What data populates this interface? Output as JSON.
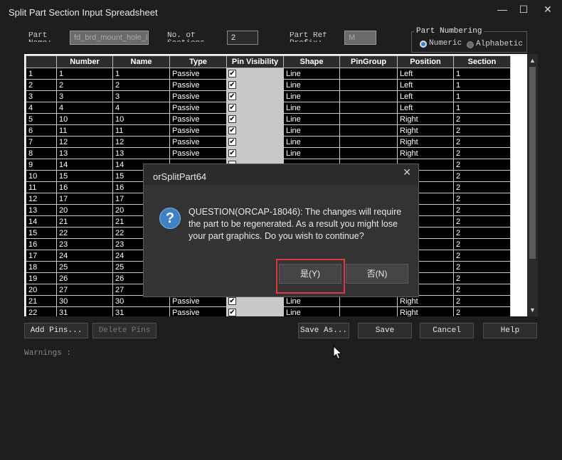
{
  "window": {
    "title": "Split Part Section Input Spreadsheet",
    "minimize": "—",
    "maximize": "☐",
    "close": "✕"
  },
  "form": {
    "part_name_label": "Part Name:",
    "part_name_value": "fd_brd_mount_hole_ii",
    "sections_label": "No. of Sections:",
    "sections_value": "2",
    "prefix_label": "Part Ref Prefix:",
    "prefix_value": "M",
    "numbering_title": "Part Numbering",
    "numeric_label": "Numeric",
    "alphabetic_label": "Alphabetic",
    "numbering_selected": "Numeric"
  },
  "grid": {
    "columns": [
      "",
      "Number",
      "Name",
      "Type",
      "Pin Visibility",
      "Shape",
      "PinGroup",
      "Position",
      "Section"
    ],
    "rows": [
      [
        "1",
        "1",
        "1",
        "Passive",
        "✔",
        "Line",
        "",
        "Left",
        "1"
      ],
      [
        "2",
        "2",
        "2",
        "Passive",
        "✔",
        "Line",
        "",
        "Left",
        "1"
      ],
      [
        "3",
        "3",
        "3",
        "Passive",
        "✔",
        "Line",
        "",
        "Left",
        "1"
      ],
      [
        "4",
        "4",
        "4",
        "Passive",
        "✔",
        "Line",
        "",
        "Left",
        "1"
      ],
      [
        "5",
        "10",
        "10",
        "Passive",
        "✔",
        "Line",
        "",
        "Right",
        "2"
      ],
      [
        "6",
        "11",
        "11",
        "Passive",
        "✔",
        "Line",
        "",
        "Right",
        "2"
      ],
      [
        "7",
        "12",
        "12",
        "Passive",
        "✔",
        "Line",
        "",
        "Right",
        "2"
      ],
      [
        "8",
        "13",
        "13",
        "Passive",
        "✔",
        "Line",
        "",
        "Right",
        "2"
      ],
      [
        "9",
        "14",
        "14",
        "",
        "",
        "",
        "",
        "",
        "2"
      ],
      [
        "10",
        "15",
        "15",
        "",
        "",
        "",
        "",
        "",
        "2"
      ],
      [
        "11",
        "16",
        "16",
        "",
        "",
        "",
        "",
        "",
        "2"
      ],
      [
        "12",
        "17",
        "17",
        "",
        "",
        "",
        "",
        "",
        "2"
      ],
      [
        "13",
        "20",
        "20",
        "",
        "",
        "",
        "",
        "",
        "2"
      ],
      [
        "14",
        "21",
        "21",
        "",
        "",
        "",
        "",
        "",
        "2"
      ],
      [
        "15",
        "22",
        "22",
        "",
        "",
        "",
        "",
        "",
        "2"
      ],
      [
        "16",
        "23",
        "23",
        "",
        "",
        "",
        "",
        "",
        "2"
      ],
      [
        "17",
        "24",
        "24",
        "",
        "",
        "",
        "",
        "",
        "2"
      ],
      [
        "18",
        "25",
        "25",
        "",
        "",
        "",
        "",
        "",
        "2"
      ],
      [
        "19",
        "26",
        "26",
        "",
        "",
        "",
        "",
        "",
        "2"
      ],
      [
        "20",
        "27",
        "27",
        "",
        "",
        "",
        "",
        "",
        "2"
      ],
      [
        "21",
        "30",
        "30",
        "Passive",
        "✔",
        "Line",
        "",
        "Right",
        "2"
      ],
      [
        "22",
        "31",
        "31",
        "Passive",
        "✔",
        "Line",
        "",
        "Right",
        "2"
      ]
    ]
  },
  "buttons": {
    "add_pins": "Add Pins...",
    "delete_pins": "Delete Pins",
    "save_as": "Save As...",
    "save": "Save",
    "cancel": "Cancel",
    "help": "Help"
  },
  "warnings_label": "Warnings :",
  "dialog": {
    "title": "orSplitPart64",
    "close": "✕",
    "icon": "?",
    "message": "QUESTION(ORCAP-18046): The changes will require the part to be regenerated. As a result you might lose your part graphics. Do you wish to continue?",
    "yes_label": "是(Y)",
    "no_label": "否(N)"
  },
  "colors": {
    "highlight": "#e0383f",
    "question_icon": "#3d82c4"
  }
}
